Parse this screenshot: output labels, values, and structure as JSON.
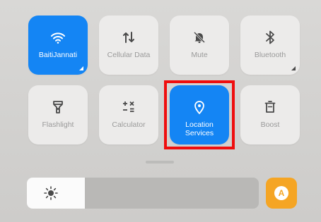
{
  "tiles": {
    "wifi": {
      "label": "BaitiJannati",
      "active": true,
      "icon": "wifi-icon"
    },
    "cellular": {
      "label": "Cellular Data",
      "active": false,
      "icon": "cellular-data-icon"
    },
    "mute": {
      "label": "Mute",
      "active": false,
      "icon": "bell-off-icon"
    },
    "bluetooth": {
      "label": "Bluetooth",
      "active": false,
      "icon": "bluetooth-icon"
    },
    "flashlight": {
      "label": "Flashlight",
      "active": false,
      "icon": "flashlight-icon"
    },
    "calculator": {
      "label": "Calculator",
      "active": false,
      "icon": "calculator-icon"
    },
    "location": {
      "label": "Location Services",
      "active": true,
      "icon": "location-pin-icon"
    },
    "boost": {
      "label": "Boost",
      "active": false,
      "icon": "trash-icon"
    }
  },
  "brightness": {
    "level": 0.25,
    "icon": "sun-icon"
  },
  "auto_brightness": {
    "letter": "A",
    "color": "#f5a524"
  },
  "colors": {
    "accent": "#1485f4",
    "highlight": "#ef0e0e"
  }
}
